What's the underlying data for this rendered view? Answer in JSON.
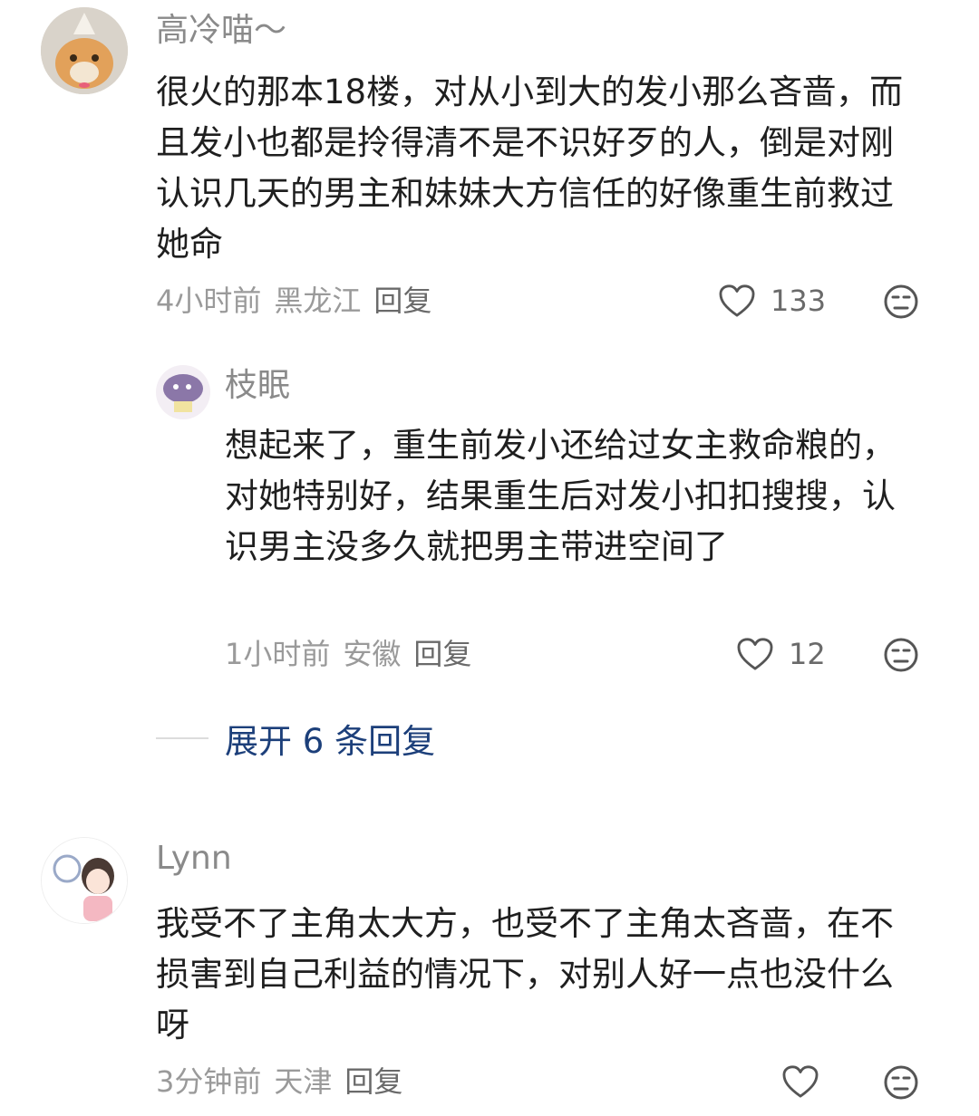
{
  "comments": [
    {
      "username": "高冷喵～",
      "avatar": "cat-avatar",
      "text": "很火的那本18楼，对从小到大的发小那么吝啬，而且发小也都是拎得清不是不识好歹的人，倒是对刚认识几天的男主和妹妹大方信任的好像重生前救过她命",
      "time": "4小时前",
      "location": "黑龙江",
      "reply_label": "回复",
      "likes": "133",
      "replies": [
        {
          "username": "枝眠",
          "avatar": "cartoon-avatar",
          "text": "想起来了，重生前发小还给过女主救命粮的，对她特别好，结果重生后对发小扣扣搜搜，认识男主没多久就把男主带进空间了",
          "time": "1小时前",
          "location": "安徽",
          "reply_label": "回复",
          "likes": "12"
        }
      ],
      "expand_label": "展开 6 条回复"
    },
    {
      "username": "Lynn",
      "avatar": "girl-avatar",
      "text": "我受不了主角太大方，也受不了主角太吝啬，在不损害到自己利益的情况下，对别人好一点也没什么呀",
      "time": "3分钟前",
      "location": "天津",
      "reply_label": "回复",
      "likes": ""
    }
  ],
  "icons": {
    "like": "heart-outline-icon",
    "dislike": "neutral-face-icon"
  },
  "colors": {
    "link": "#1c3f7a",
    "meta": "#9a9a9a",
    "text": "#1f1f1f"
  }
}
